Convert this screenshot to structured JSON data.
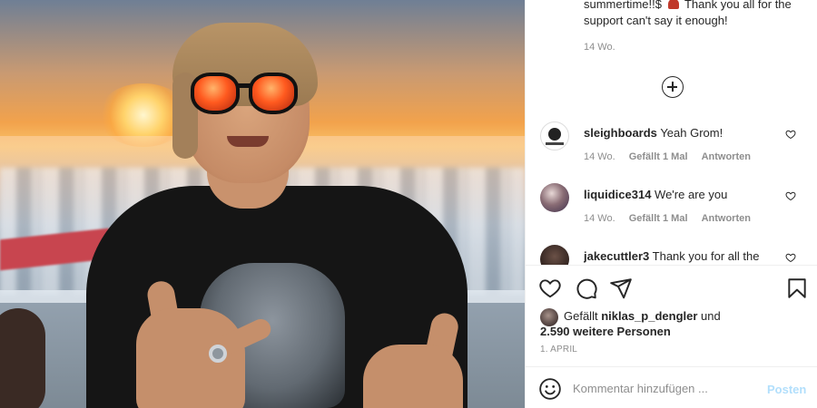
{
  "caption": {
    "text_before": "summertime!!$",
    "text_after": "Thank you all for the support can't say it enough!",
    "time": "14 Wo."
  },
  "comments": [
    {
      "username": "sleighboards",
      "text": "Yeah Grom!",
      "time": "14 Wo.",
      "likes": "Gefällt 1 Mal",
      "reply": "Antworten",
      "avatar": "sleighboards-logo-avatar"
    },
    {
      "username": "liquidice314",
      "text": "We're are you",
      "time": "14 Wo.",
      "likes": "Gefällt 1 Mal",
      "reply": "Antworten",
      "avatar": "profile-photo-avatar"
    },
    {
      "username": "jakecuttler3",
      "text": "Thank you for all the",
      "avatar": "profile-photo-avatar"
    }
  ],
  "actions": {
    "icons": [
      "heart-icon",
      "comment-bubble-icon",
      "share-paper-plane-icon",
      "bookmark-icon"
    ]
  },
  "likes": {
    "prefix": "Gefällt",
    "user": "niklas_p_dengler",
    "conj": "und",
    "others": "2.590 weitere Personen"
  },
  "post_date": "1. April",
  "composer": {
    "placeholder": "Kommentar hinzufügen ...",
    "post_label": "Posten"
  },
  "colors": {
    "text": "#262626",
    "muted": "#8e8e8e",
    "post_disabled": "#b2dffc",
    "divider": "#efefef"
  }
}
